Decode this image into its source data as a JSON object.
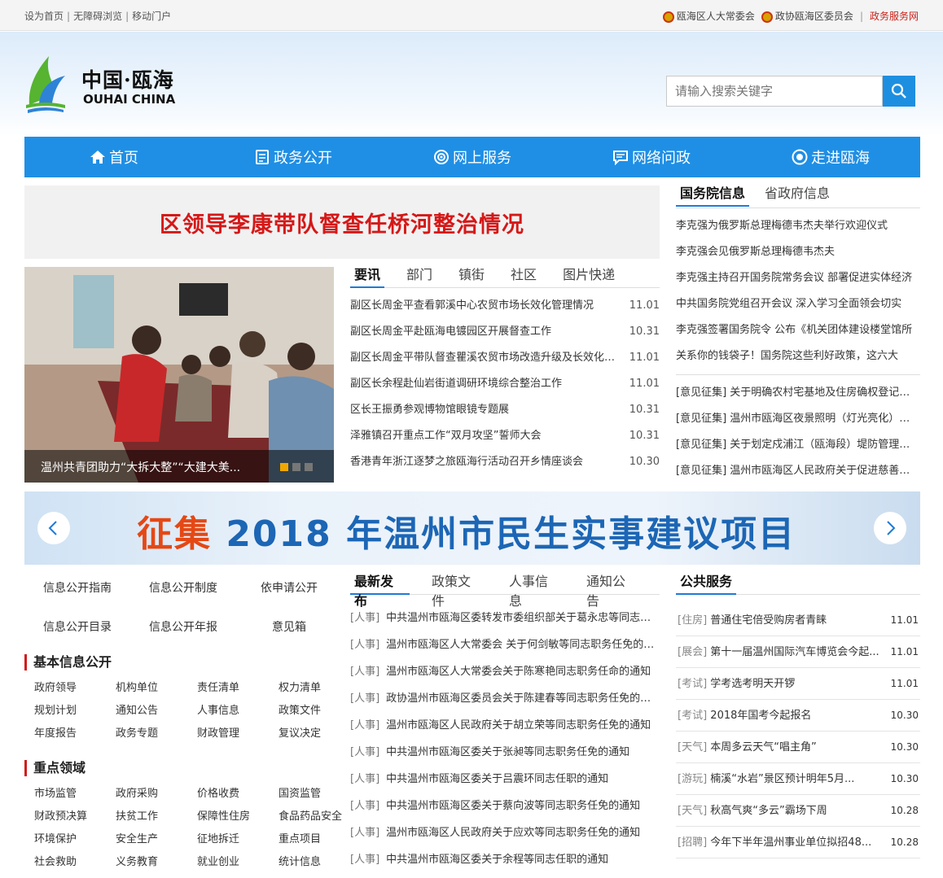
{
  "topbar": {
    "set_home": "设为首页",
    "accessibility": "无障碍浏览",
    "mobile": "移动门户",
    "npc": "瓯海区人大常委会",
    "cppcc": "政协瓯海区委员会",
    "gov_service": "政务服务网"
  },
  "logo": {
    "cn": "中国·瓯海",
    "en": "OUHAI CHINA"
  },
  "search": {
    "placeholder": "请输入搜索关键字"
  },
  "nav": [
    {
      "label": "首页",
      "icon": "home-icon"
    },
    {
      "label": "政务公开",
      "icon": "document-icon"
    },
    {
      "label": "网上服务",
      "icon": "service-icon"
    },
    {
      "label": "网络问政",
      "icon": "chat-icon"
    },
    {
      "label": "走进瓯海",
      "icon": "eye-icon"
    }
  ],
  "headline": "区领导李康带队督查任桥河整治情况",
  "photo": {
    "caption": "温州共青团助力“大拆大整”“大建大美..."
  },
  "news_tabs": [
    "要讯",
    "部门",
    "镇街",
    "社区",
    "图片快递"
  ],
  "news": [
    {
      "title": "副区长周金平查看郭溪中心农贸市场长效化管理情况",
      "date": "11.01"
    },
    {
      "title": "副区长周金平赴瓯海电镀园区开展督查工作",
      "date": "10.31"
    },
    {
      "title": "副区长周金平带队督查瞿溪农贸市场改造升级及长效化管理",
      "date": "11.01"
    },
    {
      "title": "副区长余程赴仙岩街道调研环境综合整治工作",
      "date": "11.01"
    },
    {
      "title": "区长王振勇参观博物馆眼镜专题展",
      "date": "10.31"
    },
    {
      "title": "泽雅镇召开重点工作“双月攻坚”誓师大会",
      "date": "10.31"
    },
    {
      "title": "香港青年浙江逐梦之旅瓯海行活动召开乡情座谈会",
      "date": "10.30"
    }
  ],
  "state_tabs": [
    "国务院信息",
    "省政府信息"
  ],
  "state_news": [
    "李克强为俄罗斯总理梅德韦杰夫举行欢迎仪式",
    "李克强会见俄罗斯总理梅德韦杰夫",
    "李克强主持召开国务院常务会议 部署促进实体经济",
    "中共国务院党组召开会议 深入学习全面领会切实",
    "李克强签署国务院令 公布《机关团体建设楼堂馆所",
    "关系你的钱袋子！国务院这些利好政策，这六大"
  ],
  "opinions": [
    "[意见征集] 关于明确农村宅基地及住房确权登记有关",
    "[意见征集] 温州市瓯海区夜景照明（灯光亮化）规划",
    "[意见征集] 关于划定戍浦江（瓯海段）堤防管理范围",
    "[意见征集] 温州市瓯海区人民政府关于促进慈善事业"
  ],
  "banner": {
    "highlight": "征集",
    "text": " 2018 年温州市民生实事建议项目"
  },
  "info_links": [
    "信息公开指南",
    "信息公开制度",
    "依申请公开",
    "信息公开目录",
    "信息公开年报",
    "意见箱"
  ],
  "basic": {
    "title": "基本信息公开",
    "items": [
      "政府领导",
      "机构单位",
      "责任清单",
      "权力清单",
      "规划计划",
      "通知公告",
      "人事信息",
      "政策文件",
      "年度报告",
      "政务专题",
      "财政管理",
      "复议决定"
    ]
  },
  "key": {
    "title": "重点领域",
    "items": [
      "市场监管",
      "政府采购",
      "价格收费",
      "国资监管",
      "财政预决算",
      "扶贫工作",
      "保障性住房",
      "食品药品安全",
      "环境保护",
      "安全生产",
      "征地拆迁",
      "重点项目",
      "社会救助",
      "义务教育",
      "就业创业",
      "统计信息"
    ]
  },
  "latest_tabs": [
    "最新发布",
    "政策文件",
    "人事信息",
    "通知公告"
  ],
  "latest": [
    {
      "tag": "[人事]",
      "title": "中共温州市瓯海区委转发市委组织部关于葛永忠等同志职务任免的通知"
    },
    {
      "tag": "[人事]",
      "title": "温州市瓯海区人大常委会 关于何剑敏等同志职务任免的通知"
    },
    {
      "tag": "[人事]",
      "title": "温州市瓯海区人大常委会关于陈寒艳同志职务任命的通知"
    },
    {
      "tag": "[人事]",
      "title": "政协温州市瓯海区委员会关于陈建春等同志职务任免的通知"
    },
    {
      "tag": "[人事]",
      "title": "温州市瓯海区人民政府关于胡立荣等同志职务任免的通知"
    },
    {
      "tag": "[人事]",
      "title": "中共温州市瓯海区委关于张昶等同志职务任免的通知"
    },
    {
      "tag": "[人事]",
      "title": "中共温州市瓯海区委关于吕震环同志任职的通知"
    },
    {
      "tag": "[人事]",
      "title": "中共温州市瓯海区委关于蔡向波等同志职务任免的通知"
    },
    {
      "tag": "[人事]",
      "title": "温州市瓯海区人民政府关于应欢等同志职务任免的通知"
    },
    {
      "tag": "[人事]",
      "title": "中共温州市瓯海区委关于余程等同志任职的通知"
    }
  ],
  "service": {
    "title": "公共服务",
    "items": [
      {
        "tag": "[住房]",
        "title": "普通住宅倍受购房者青睐",
        "date": "11.01"
      },
      {
        "tag": "[展会]",
        "title": "第十一届温州国际汽车博览会今起...",
        "date": "11.01"
      },
      {
        "tag": "[考试]",
        "title": "学考选考明天开锣",
        "date": "11.01"
      },
      {
        "tag": "[考试]",
        "title": "2018年国考今起报名",
        "date": "10.30"
      },
      {
        "tag": "[天气]",
        "title": "本周多云天气“唱主角”",
        "date": "10.30"
      },
      {
        "tag": "[游玩]",
        "title": "楠溪“水岩”景区预计明年5月...",
        "date": "10.30"
      },
      {
        "tag": "[天气]",
        "title": "秋高气爽“多云”霸场下周",
        "date": "10.28"
      },
      {
        "tag": "[招聘]",
        "title": "今年下半年温州事业单位拟招48...",
        "date": "10.28"
      }
    ]
  }
}
